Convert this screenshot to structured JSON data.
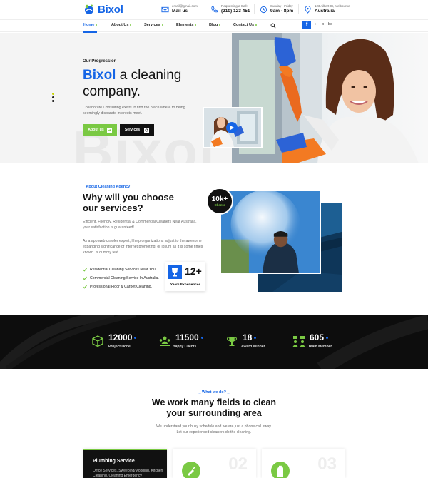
{
  "header": {
    "brand": "Bixol",
    "email": {
      "small": "email@gmail.com",
      "big": "Mail us"
    },
    "phone": {
      "small": "Requesting a Call:",
      "big": "(210) 123 451"
    },
    "hours": {
      "small": "Sunday - Friday",
      "big": "9am - 8pm"
    },
    "address": {
      "small": "123 Albert St, Melbourne",
      "big": "Australia"
    }
  },
  "nav": {
    "items": [
      "Home",
      "About Us",
      "Services",
      "Elements",
      "Blog",
      "Contact Us"
    ],
    "social": [
      "f",
      "t",
      "p",
      "be"
    ]
  },
  "hero": {
    "eyebrow": "Our Progression",
    "title_accent": "Bixol",
    "title_rest": " a cleaning",
    "title_line2": "company.",
    "description": "Collaborate Consulting exists to find the place where to being seemingly disparate interests meet.",
    "btn_about": "About us",
    "btn_services": "Services",
    "bg_text": "Bixol"
  },
  "about": {
    "eyebrow": "_ About Cleaning Agency _",
    "title": "Why will you choose our services?",
    "p1": "Efficient, Friendly, Residential & Commercial Cleaners Near Australia, your satisfaction is guaranteed!",
    "p2": "As a app web crawler expert, I help organizations adjust to the awesome expanding significance of internet promoting. or lpsum as it is some times known. is dummy text.",
    "checks": [
      "Residential Cleaning Services Near You!",
      "Commercial Cleaning Service In Australia.",
      "Professional Floor & Carpet Cleaning."
    ],
    "years_num": "12+",
    "years_label": "Years Experiences",
    "clients_num": "10k+",
    "clients_label": "Clients"
  },
  "counters": [
    {
      "num": "12000",
      "label": "Project Done",
      "icon": "box-icon"
    },
    {
      "num": "11500",
      "label": "Happy Clients",
      "icon": "people-icon"
    },
    {
      "num": "18",
      "label": "Award Winner",
      "icon": "trophy-icon"
    },
    {
      "num": "605",
      "label": "Team Member",
      "icon": "team-icon"
    }
  ],
  "services": {
    "eyebrow": "_ What we do? _",
    "title_line1": "We work many fields to clean",
    "title_line2": "your surrounding area",
    "description": "We understand your busy schedule and we are just a phone call away. Let our experienced cleaners do the cleaning.",
    "cards": [
      {
        "title": "Plumbing Service",
        "desc": "Office Services, Sweeping/Mopping, Kitchen Cleaning, Cleaning Emergency"
      },
      {
        "num": "02"
      },
      {
        "num": "03"
      }
    ]
  },
  "colors": {
    "primary": "#1565e6",
    "accent": "#7ac943",
    "dark": "#0d0d0d"
  }
}
